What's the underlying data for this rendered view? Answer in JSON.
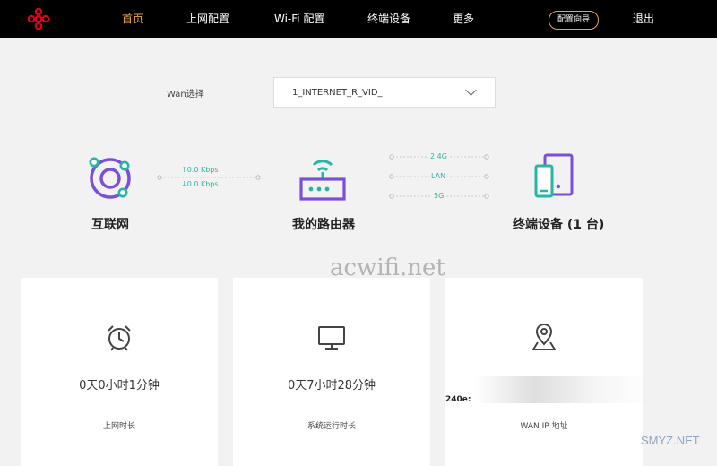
{
  "nav": {
    "items": [
      "首页",
      "上网配置",
      "Wi-Fi 配置",
      "终端设备",
      "更多"
    ],
    "wizard": "配置向导",
    "logout": "退出"
  },
  "wan": {
    "label": "Wan选择",
    "selected": "1_INTERNET_R_VID_"
  },
  "internet": {
    "label": "互联网",
    "up": "↑0.0 Kbps",
    "down": "↓0.0 Kbps"
  },
  "router": {
    "label": "我的路由器",
    "bands": [
      "2.4G",
      "LAN",
      "5G"
    ]
  },
  "devices": {
    "label": "终端设备 (1 台)"
  },
  "cards": [
    {
      "value": "0天0小时1分钟",
      "label": "上网时长",
      "icon": "alarm-clock-icon"
    },
    {
      "value": "0天7小时28分钟",
      "label": "系统运行时长",
      "icon": "monitor-icon"
    },
    {
      "value": "240e:",
      "label": "WAN IP 地址",
      "icon": "map-pin-icon"
    }
  ],
  "watermarks": [
    "acwifi.net",
    "SMYZ.NET"
  ],
  "colors": {
    "accent": "#e7a64d",
    "teal": "#27b6a4",
    "purple": "#7b4fd8",
    "topbar": "#000000"
  }
}
